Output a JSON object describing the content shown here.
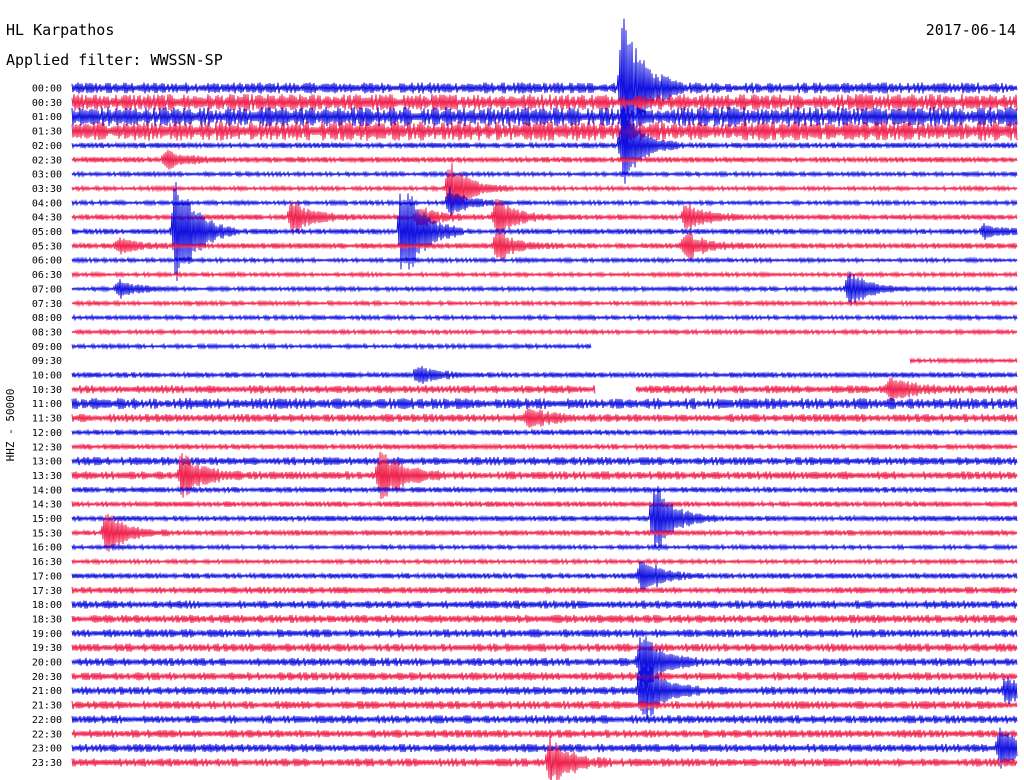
{
  "header": {
    "station": "HL Karpathos",
    "date": "2017-06-14",
    "filter": "Applied filter: WWSSN-SP"
  },
  "chart_data": {
    "type": "seismogram",
    "ylabel": "HHZ - 50000",
    "rows": [
      "00:00",
      "00:30",
      "01:00",
      "01:30",
      "02:00",
      "02:30",
      "03:00",
      "03:30",
      "04:00",
      "04:30",
      "05:00",
      "05:30",
      "06:00",
      "06:30",
      "07:00",
      "07:30",
      "08:00",
      "08:30",
      "09:00",
      "09:30",
      "10:00",
      "10:30",
      "11:00",
      "11:30",
      "12:00",
      "12:30",
      "13:00",
      "13:30",
      "14:00",
      "14:30",
      "15:00",
      "15:30",
      "16:00",
      "16:30",
      "17:00",
      "17:30",
      "18:00",
      "18:30",
      "19:00",
      "19:30",
      "20:00",
      "20:30",
      "21:00",
      "21:30",
      "22:00",
      "22:30",
      "23:00",
      "23:30"
    ],
    "trace_colors": [
      "#1010e0",
      "#f0204c"
    ],
    "noise_level": [
      4,
      6,
      7,
      7,
      2,
      2,
      1.5,
      1.5,
      1.5,
      2,
      2,
      2,
      1.5,
      1.5,
      1.5,
      1.5,
      1.5,
      1.5,
      1.5,
      1.5,
      2,
      3,
      4,
      3,
      2,
      2,
      3,
      3,
      2,
      2,
      2,
      2,
      1.5,
      1.5,
      2,
      2.5,
      3,
      3,
      3,
      3,
      3,
      3,
      3,
      3,
      3,
      3,
      3,
      3
    ],
    "events": [
      {
        "row": 0,
        "minute": 17.5,
        "amp": 80
      },
      {
        "row": 4,
        "minute": 17.5,
        "amp": 40
      },
      {
        "row": 5,
        "minute": 3,
        "amp": 10
      },
      {
        "row": 7,
        "minute": 12,
        "amp": 30
      },
      {
        "row": 8,
        "minute": 12,
        "amp": 15
      },
      {
        "row": 9,
        "minute": 7,
        "amp": 18
      },
      {
        "row": 9,
        "minute": 11,
        "amp": 12
      },
      {
        "row": 9,
        "minute": 13.5,
        "amp": 20
      },
      {
        "row": 9,
        "minute": 19.5,
        "amp": 14
      },
      {
        "row": 10,
        "minute": 3.3,
        "amp": 70
      },
      {
        "row": 10,
        "minute": 10.5,
        "amp": 60
      },
      {
        "row": 10,
        "minute": 29,
        "amp": 8
      },
      {
        "row": 11,
        "minute": 1.5,
        "amp": 8
      },
      {
        "row": 11,
        "minute": 13.5,
        "amp": 15
      },
      {
        "row": 11,
        "minute": 19.5,
        "amp": 16
      },
      {
        "row": 14,
        "minute": 1.5,
        "amp": 10
      },
      {
        "row": 14,
        "minute": 24.7,
        "amp": 20
      },
      {
        "row": 20,
        "minute": 11,
        "amp": 10
      },
      {
        "row": 21,
        "minute": 26,
        "amp": 12
      },
      {
        "row": 23,
        "minute": 14.5,
        "amp": 10
      },
      {
        "row": 27,
        "minute": 3.5,
        "amp": 25
      },
      {
        "row": 27,
        "minute": 9.8,
        "amp": 30
      },
      {
        "row": 30,
        "minute": 18.5,
        "amp": 40
      },
      {
        "row": 31,
        "minute": 1.1,
        "amp": 22
      },
      {
        "row": 34,
        "minute": 18.1,
        "amp": 20
      },
      {
        "row": 40,
        "minute": 18.1,
        "amp": 30
      },
      {
        "row": 42,
        "minute": 18.1,
        "amp": 40
      },
      {
        "row": 42,
        "minute": 29.7,
        "amp": 15
      },
      {
        "row": 46,
        "minute": 29.5,
        "amp": 20
      },
      {
        "row": 47,
        "minute": 15.2,
        "amp": 25
      }
    ],
    "gaps": [
      {
        "row": 18,
        "from_minute": 16.5,
        "to_minute": 30
      },
      {
        "row": 19,
        "from_minute": 0,
        "to_minute": 26.6
      },
      {
        "row": 21,
        "from_minute": 16.6,
        "to_minute": 17.9
      }
    ]
  }
}
